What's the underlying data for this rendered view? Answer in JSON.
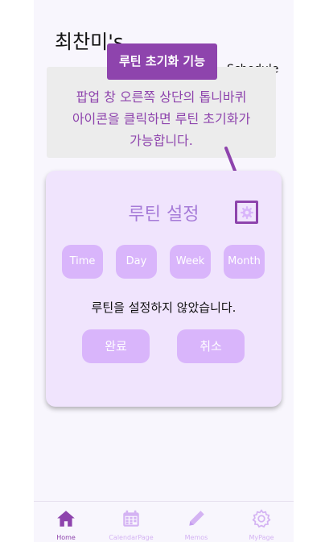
{
  "header": {
    "title": "최찬미's",
    "title_tail": "Schedule"
  },
  "tooltip": {
    "badge": "루틴 초기화 기능",
    "lines": [
      "팝업 창 오른쪽 상단의 톱니바퀴",
      "아이콘을 클릭하면 루틴 초기화가",
      "가능합니다."
    ]
  },
  "card": {
    "title": "루틴 설정",
    "gear_icon": "gear-icon",
    "periods": [
      "Time",
      "Day",
      "Week",
      "Month"
    ],
    "status": "루틴을 설정하지 않았습니다.",
    "confirm_label": "완료",
    "cancel_label": "취소"
  },
  "nav": {
    "items": [
      {
        "label": "Home",
        "icon": "home-icon",
        "active": true
      },
      {
        "label": "CalendarPage",
        "icon": "calendar-icon",
        "active": false
      },
      {
        "label": "Memos",
        "icon": "pencil-icon",
        "active": false
      },
      {
        "label": "MyPage",
        "icon": "gear-icon",
        "active": false
      }
    ]
  },
  "colors": {
    "accent": "#8e44ad",
    "button": "#d9b5fb",
    "card": "#f0e4fd",
    "inactive": "#d4b3f3"
  }
}
